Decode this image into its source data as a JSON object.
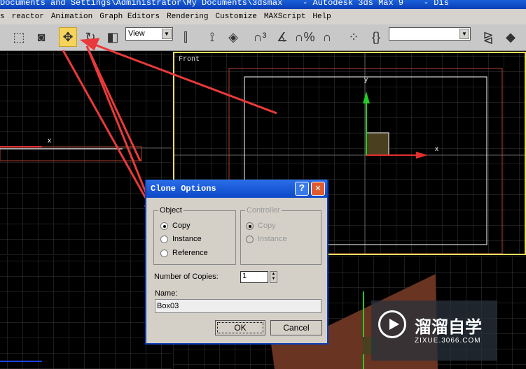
{
  "window": {
    "title": "Documents and Settings\\Administrator\\My Documents\\3dsmax    - Autodesk 3ds Max 9    - Dis"
  },
  "menu": [
    "s",
    "reactor",
    "Animation",
    "Graph Editors",
    "Rendering",
    "Customize",
    "MAXScript",
    "Help"
  ],
  "toolbar": {
    "reference_coord": "View",
    "named_selection": "",
    "active_tool": "select-and-move"
  },
  "viewports": {
    "front_label": "Front",
    "axis_x": "x",
    "axis_y": "y"
  },
  "dialog": {
    "title": "Clone Options",
    "help": "?",
    "close": "✕",
    "object": {
      "label": "Object",
      "options": [
        "Copy",
        "Instance",
        "Reference"
      ],
      "selected": "Copy"
    },
    "controller": {
      "label": "Controller",
      "options": [
        "Copy",
        "Instance"
      ],
      "selected": "Copy",
      "disabled": true
    },
    "copies_label": "Number of Copies:",
    "copies_value": "1",
    "name_label": "Name:",
    "name_value": "Box03",
    "ok": "OK",
    "cancel": "Cancel"
  },
  "watermark": {
    "brand": "溜溜自学",
    "url": "ZIXUE.3066.COM"
  },
  "colors": {
    "accent": "#f6d35a",
    "annotation_arrow": "#e83a3a",
    "title_blue": "#0c48c8"
  }
}
